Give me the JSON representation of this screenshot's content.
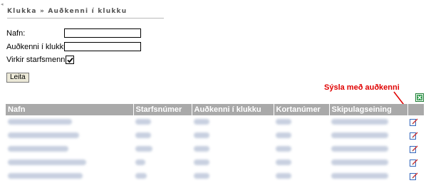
{
  "header": {
    "title": "Klukka » Auðkenni í klukku"
  },
  "form": {
    "nafn_label": "Nafn:",
    "nafn_value": "",
    "audkenni_label": "Auðkenni í klukku:",
    "audkenni_value": "",
    "virkir_label": "Virkir starfsmenn:",
    "virkir_checked": true,
    "search_button": "Leita"
  },
  "annotation": {
    "text": "Sýsla með auðkenni",
    "color": "#e00000"
  },
  "table": {
    "columns": [
      "Nafn",
      "Starfsnúmer",
      "Auðkenni í klukku",
      "Kortanúmer",
      "Skipulagseining",
      ""
    ],
    "header_color": "#a9a9a9",
    "rows": [
      {
        "note": "blurred"
      },
      {
        "note": "blurred"
      },
      {
        "note": "blurred"
      },
      {
        "note": "blurred"
      },
      {
        "note": "blurred"
      }
    ],
    "row_action_icon": "edit-icon"
  },
  "toolbar": {
    "export_icon": "excel-export-icon"
  }
}
